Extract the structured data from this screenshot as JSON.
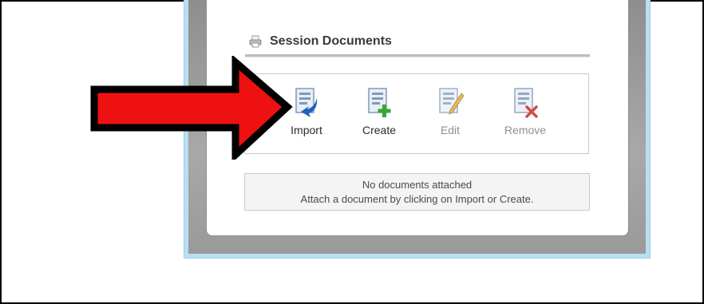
{
  "section": {
    "title": "Session Documents",
    "icon": "printer-icon"
  },
  "toolbar": {
    "buttons": [
      {
        "label": "Import",
        "icon": "import-document-icon",
        "enabled": true
      },
      {
        "label": "Create",
        "icon": "create-document-icon",
        "enabled": true
      },
      {
        "label": "Edit",
        "icon": "edit-document-icon",
        "enabled": false
      },
      {
        "label": "Remove",
        "icon": "remove-document-icon",
        "enabled": false
      }
    ]
  },
  "status": {
    "line1": "No documents attached",
    "line2": "Attach a document by clicking on Import or Create."
  },
  "annotation": {
    "icon": "red-arrow-icon",
    "color": "#ee1111"
  },
  "colors": {
    "window_border": "#b9dff3",
    "add_green": "#3aa53a",
    "remove_red": "#cc2a2a",
    "import_blue": "#1f5fbf",
    "edit_pencil": "#e3a21a"
  }
}
